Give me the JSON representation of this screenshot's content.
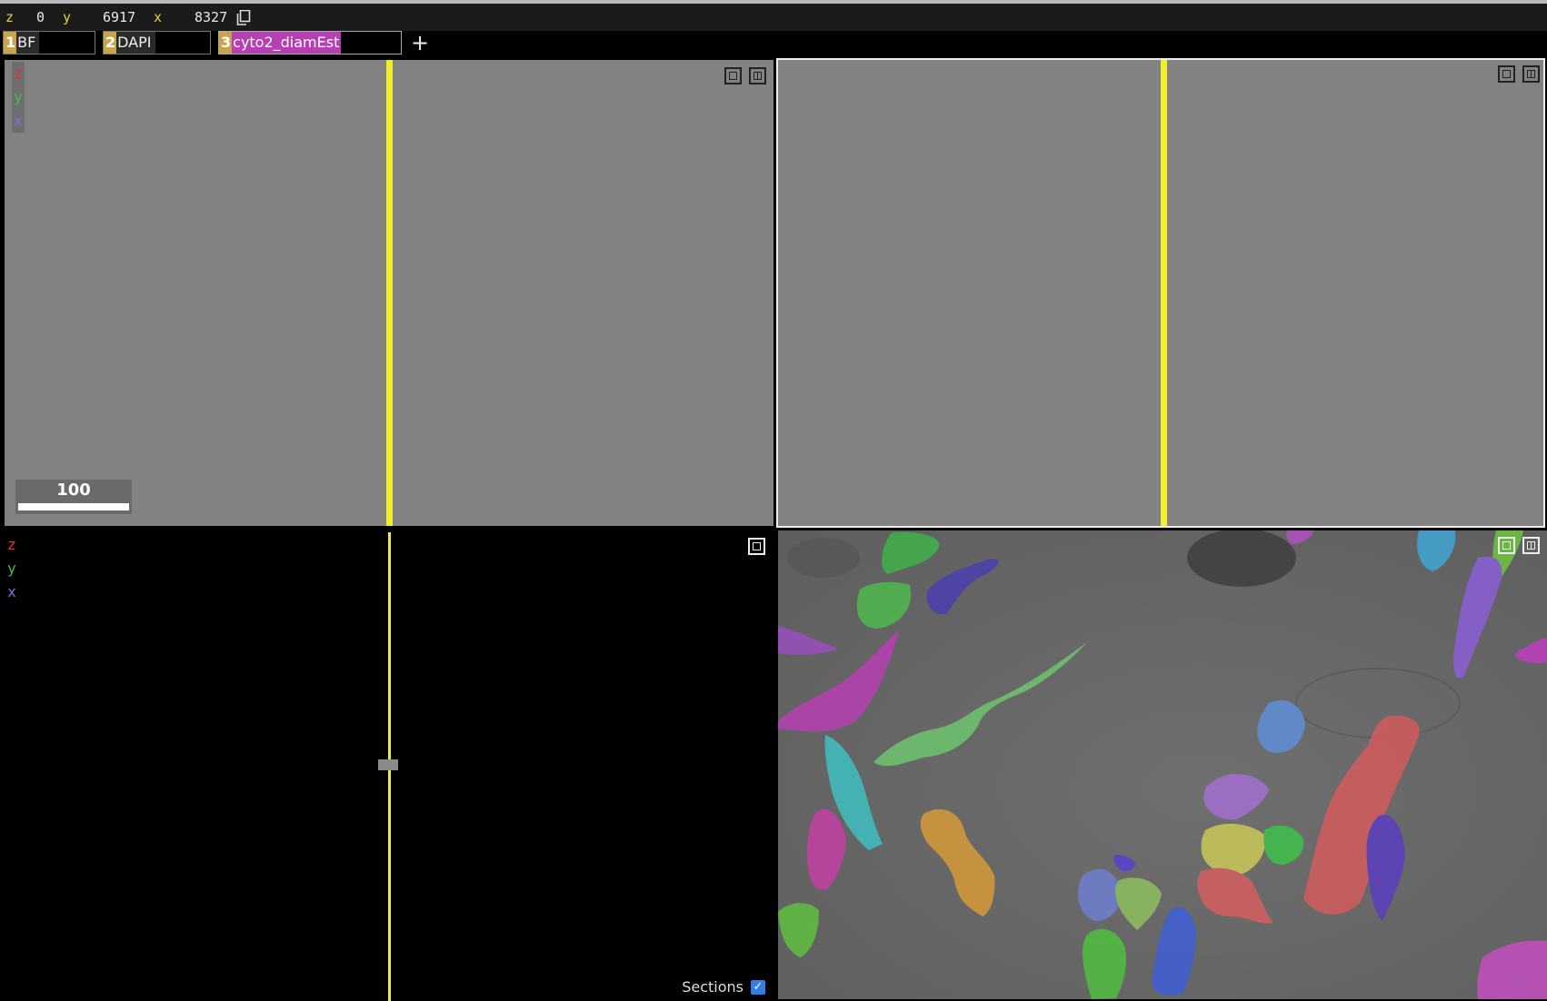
{
  "coordinates": {
    "z_label": "z",
    "z_value": "0",
    "y_label": "y",
    "y_value": "6917",
    "x_label": "x",
    "x_value": "8327",
    "copy_icon": "copy-icon"
  },
  "layers": [
    {
      "index": "1",
      "name": "BF",
      "active": false
    },
    {
      "index": "2",
      "name": "DAPI",
      "active": false
    },
    {
      "index": "3",
      "name": "cyto2_diamEst",
      "active": true
    }
  ],
  "add_layer_label": "+",
  "axes": {
    "z": "z",
    "y": "y",
    "x": "x"
  },
  "scale_bar": {
    "value": "100"
  },
  "sections": {
    "label": "Sections",
    "checked": true
  },
  "colors": {
    "cursor_line": "#f2ee2a",
    "axis_z": "#e03030",
    "axis_y": "#3fc03f",
    "axis_x": "#7272e0",
    "active_layer": "#b53fb3",
    "layer_index_bg": "#c9a54a"
  },
  "icons": [
    "copy-icon",
    "maximize-panel-icon",
    "split-panel-icon",
    "checkbox-checked-icon"
  ]
}
